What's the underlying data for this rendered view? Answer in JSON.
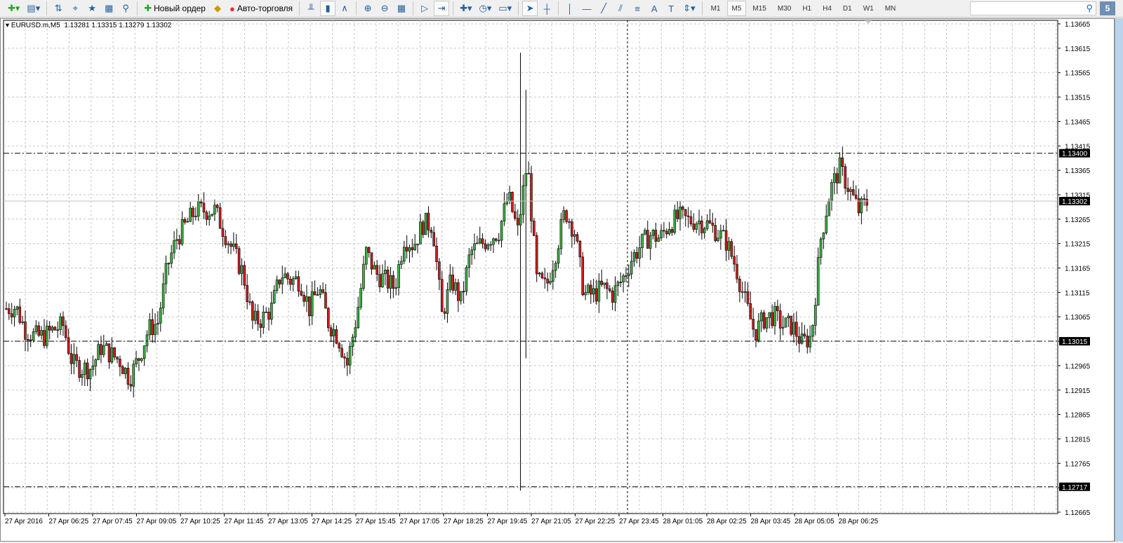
{
  "toolbar": {
    "new_order_label": "Новый ордер",
    "autotrading_label": "Авто-торговля",
    "icons": [
      "new-chart-icon",
      "profiles-icon",
      "market-watch-icon",
      "navigator-crosshair-icon",
      "favorites-icon",
      "data-window-icon",
      "strategy-tester-icon",
      "new-order-icon",
      "metaeditor-icon",
      "autotrading-icon",
      "bar-chart-icon",
      "candlesticks-icon",
      "line-chart-icon",
      "zoom-in-icon",
      "zoom-out-icon",
      "tile-windows-icon",
      "chart-shift-icon",
      "autoscroll-icon",
      "indicators-icon",
      "periods-icon",
      "templates-icon",
      "cursor-icon",
      "crosshair-icon",
      "vertical-line-icon",
      "horizontal-line-icon",
      "trendline-icon",
      "equidistant-channel-icon",
      "fibonacci-icon",
      "text-icon",
      "text-label-icon",
      "arrows-icon"
    ],
    "timeframes": [
      "M1",
      "M5",
      "M15",
      "M30",
      "H1",
      "H4",
      "D1",
      "W1",
      "MN"
    ],
    "active_timeframe": "M5",
    "search_value": "",
    "badge": "5"
  },
  "chart_info": {
    "symbol": "EURUSD.m,M5",
    "open": "1.13281",
    "high": "1.13315",
    "low": "1.13279",
    "close": "1.13302"
  },
  "chart_data": {
    "type": "candlestick",
    "title": "EURUSD.m,M5",
    "ylim": [
      1.12645,
      1.13685
    ],
    "y_ticks": [
      "1.13665",
      "1.13615",
      "1.13565",
      "1.13515",
      "1.13465",
      "1.13415",
      "1.13365",
      "1.13315",
      "1.13265",
      "1.13215",
      "1.13165",
      "1.13115",
      "1.13065",
      "1.13015",
      "1.12965",
      "1.12915",
      "1.12865",
      "1.12815",
      "1.12765",
      "1.12715",
      "1.12665"
    ],
    "x_ticks": [
      "27 Apr 2016",
      "27 Apr 06:25",
      "27 Apr 07:45",
      "27 Apr 09:05",
      "27 Apr 10:25",
      "27 Apr 11:45",
      "27 Apr 13:05",
      "27 Apr 14:25",
      "27 Apr 15:45",
      "27 Apr 17:05",
      "27 Apr 18:25",
      "27 Apr 19:45",
      "27 Apr 21:05",
      "27 Apr 22:25",
      "27 Apr 23:45",
      "28 Apr 01:05",
      "28 Apr 02:25",
      "28 Apr 03:45",
      "28 Apr 05:05",
      "28 Apr 06:25"
    ],
    "price_path": [
      1.13082,
      1.13085,
      1.13039,
      1.13025,
      1.13025,
      1.13039,
      1.13047,
      1.12968,
      1.1296,
      1.1296,
      1.13003,
      1.12989,
      1.12975,
      1.12939,
      1.12982,
      1.13039,
      1.13054,
      1.13169,
      1.13226,
      1.13255,
      1.13283,
      1.13283,
      1.13283,
      1.1324,
      1.13197,
      1.13154,
      1.13054,
      1.13061,
      1.13082,
      1.13154,
      1.1314,
      1.1314,
      1.13082,
      1.13125,
      1.13054,
      1.13025,
      1.12968,
      1.13068,
      1.13197,
      1.13154,
      1.1314,
      1.13125,
      1.13226,
      1.13212,
      1.13255,
      1.13255,
      1.13068,
      1.1314,
      1.13097,
      1.13197,
      1.13212,
      1.13226,
      1.1324,
      1.13312,
      1.1324,
      1.13384,
      1.1314,
      1.13125,
      1.13197,
      1.13283,
      1.1324,
      1.13111,
      1.13111,
      1.13125,
      1.13111,
      1.1314,
      1.13183,
      1.13212,
      1.13233,
      1.13226,
      1.13255,
      1.13269,
      1.13262,
      1.13262,
      1.13255,
      1.1324,
      1.13219,
      1.13169,
      1.13097,
      1.13032,
      1.13061,
      1.13068,
      1.13047,
      1.13047,
      1.13011,
      1.13025,
      1.13226,
      1.13326,
      1.13369,
      1.13326,
      1.13283,
      1.13302
    ],
    "spikes": [
      {
        "index": 190,
        "high": 1.13606,
        "low": 1.12709
      },
      {
        "index": 192,
        "high": 1.1353,
        "low": 1.1298
      }
    ],
    "levels": [
      {
        "price": "1.13400",
        "style": "dash-dot"
      },
      {
        "price": "1.13015",
        "style": "dash-dot"
      },
      {
        "price": "1.12717",
        "style": "dash-dot"
      }
    ],
    "bid_line": "1.13302",
    "bull_color": "#3cb043",
    "bear_color": "#cc1f1f"
  }
}
